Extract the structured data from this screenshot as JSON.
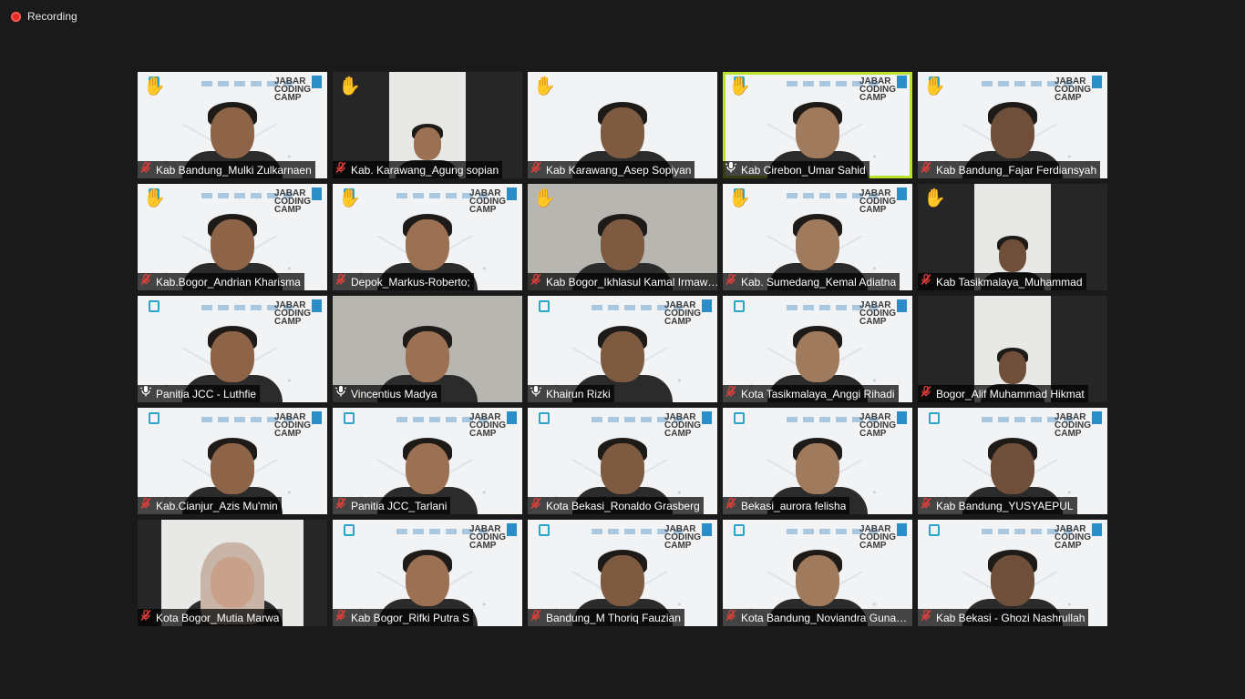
{
  "recording": {
    "label": "Recording"
  },
  "participants": [
    {
      "name": "Kab Bandung_Mulki Zulkarnaen",
      "hand": true,
      "mic": "muted",
      "bg": "jcc"
    },
    {
      "name": "Kab. Karawang_Agung sopian",
      "hand": true,
      "mic": "muted",
      "bg": "dark"
    },
    {
      "name": "Kab Karawang_Asep Sopiyan",
      "hand": true,
      "mic": "muted",
      "bg": "light"
    },
    {
      "name": "Kab Cirebon_Umar Sahid",
      "hand": true,
      "mic": "speaking",
      "bg": "jcc",
      "active": true
    },
    {
      "name": "Kab Bandung_Fajar Ferdiansyah",
      "hand": true,
      "mic": "muted",
      "bg": "jcc"
    },
    {
      "name": "Kab.Bogor_Andrian Kharisma",
      "hand": true,
      "mic": "muted",
      "bg": "jcc"
    },
    {
      "name": "Depok_Markus-Roberto;",
      "hand": true,
      "mic": "muted",
      "bg": "jcc"
    },
    {
      "name": "Kab Bogor_Ikhlasul Kamal Irmawan",
      "hand": true,
      "mic": "muted",
      "bg": "photo"
    },
    {
      "name": "Kab. Sumedang_Kemal Adiatna",
      "hand": true,
      "mic": "muted",
      "bg": "jcc"
    },
    {
      "name": "Kab Tasikmalaya_Muhammad",
      "hand": true,
      "mic": "muted",
      "bg": "dark"
    },
    {
      "name": "Panitia JCC - Luthfie",
      "hand": false,
      "mic": "speaking",
      "bg": "jcc"
    },
    {
      "name": "Vincentius Madya",
      "hand": false,
      "mic": "speaking",
      "bg": "photo"
    },
    {
      "name": "Khairun Rizki",
      "hand": false,
      "mic": "speaking",
      "bg": "jcc"
    },
    {
      "name": "Kota Tasikmalaya_Anggi Rihadi",
      "hand": false,
      "mic": "muted",
      "bg": "jcc"
    },
    {
      "name": "Bogor_Alif Muhammad Hikmat",
      "hand": false,
      "mic": "muted",
      "bg": "dark"
    },
    {
      "name": "Kab.Cianjur_Azis Mu'min",
      "hand": false,
      "mic": "muted",
      "bg": "jcc"
    },
    {
      "name": "Panitia JCC_Tarlani",
      "hand": false,
      "mic": "muted",
      "bg": "jcc"
    },
    {
      "name": "Kota Bekasi_Ronaldo Grasberg",
      "hand": false,
      "mic": "muted",
      "bg": "jcc"
    },
    {
      "name": "Bekasi_aurora felisha",
      "hand": false,
      "mic": "muted",
      "bg": "jcc"
    },
    {
      "name": "Kab Bandung_YUSYAEPUL",
      "hand": false,
      "mic": "muted",
      "bg": "jcc"
    },
    {
      "name": "Kota Bogor_Mutia Marwa",
      "hand": false,
      "mic": "muted",
      "bg": "dark"
    },
    {
      "name": "Kab Bogor_Rifki Putra S",
      "hand": false,
      "mic": "muted",
      "bg": "jcc"
    },
    {
      "name": "Bandung_M Thoriq Fauzian",
      "hand": false,
      "mic": "muted",
      "bg": "jcc"
    },
    {
      "name": "Kota Bandung_Noviandra Gunawan",
      "hand": false,
      "mic": "muted",
      "bg": "jcc"
    },
    {
      "name": "Kab Bekasi - Ghozi Nashrullah",
      "hand": false,
      "mic": "muted",
      "bg": "jcc"
    }
  ],
  "backdrop": {
    "line1": "JABAR",
    "line2": "CODING",
    "line3": "CAMP"
  },
  "colors": {
    "active_speaker": "#b9e22f",
    "raised_hand": "#f6c343",
    "muted_mic": "#e5403a"
  }
}
